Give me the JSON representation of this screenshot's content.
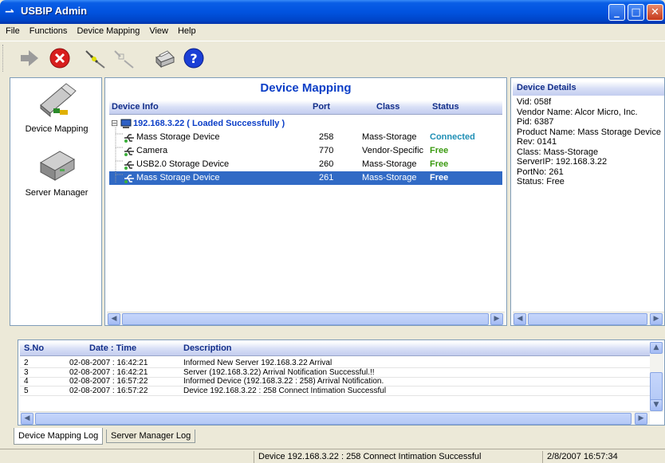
{
  "window": {
    "title": "USBIP Admin"
  },
  "menu": [
    "File",
    "Functions",
    "Device Mapping",
    "View",
    "Help"
  ],
  "toolbar": {
    "icons": [
      "arrow-right-icon",
      "stop-icon",
      "connect-icon",
      "disconnect-icon",
      "printer-icon",
      "help-icon"
    ]
  },
  "nav": {
    "items": [
      {
        "label": "Device Mapping",
        "icon": "usb-stick-icon"
      },
      {
        "label": "Server Manager",
        "icon": "server-box-icon"
      }
    ]
  },
  "mapping": {
    "title": "Device Mapping",
    "columns": [
      "Device Info",
      "Port",
      "Class",
      "Status"
    ],
    "server_label": "192.168.3.22 ( Loaded Successfully )",
    "devices": [
      {
        "name": "Mass Storage Device",
        "port": "258",
        "class": "Mass-Storage",
        "status": "Connected"
      },
      {
        "name": "Camera",
        "port": "770",
        "class": "Vendor-Specific",
        "status": "Free"
      },
      {
        "name": "USB2.0 Storage Device",
        "port": "260",
        "class": "Mass-Storage",
        "status": "Free"
      },
      {
        "name": "Mass Storage Device",
        "port": "261",
        "class": "Mass-Storage",
        "status": "Free"
      }
    ],
    "selected_index": 3,
    "status_colors": {
      "Connected": "#1f8fb5",
      "Free": "#3a9a10",
      "selected": "#ffffff"
    }
  },
  "details": {
    "header": "Device Details",
    "lines": [
      "Vid: 058f",
      "Vendor Name: Alcor Micro, Inc.",
      "Pid: 6387",
      "Product Name: Mass Storage Device",
      "Rev: 0141",
      "Class: Mass-Storage",
      "ServerIP: 192.168.3.22",
      "PortNo: 261",
      "Status: Free"
    ]
  },
  "log": {
    "columns": [
      "S.No",
      "Date : Time",
      "Description"
    ],
    "rows": [
      {
        "sno": "2",
        "time": "02-08-2007 : 16:42:21",
        "desc": "Informed New Server 192.168.3.22 Arrival"
      },
      {
        "sno": "3",
        "time": "02-08-2007 : 16:42:21",
        "desc": "Server (192.168.3.22) Arrival Notification Successful.!!"
      },
      {
        "sno": "4",
        "time": "02-08-2007 : 16:57:22",
        "desc": "Informed Device (192.168.3.22 : 258) Arrival Notification."
      },
      {
        "sno": "5",
        "time": "02-08-2007 : 16:57:22",
        "desc": "Device 192.168.3.22 : 258 Connect Intimation Successful"
      }
    ]
  },
  "tabs": [
    "Device Mapping Log",
    "Server Manager Log"
  ],
  "status": {
    "message": "Device 192.168.3.22 : 258 Connect Intimation Successful",
    "datetime": "2/8/2007 16:57:34"
  }
}
